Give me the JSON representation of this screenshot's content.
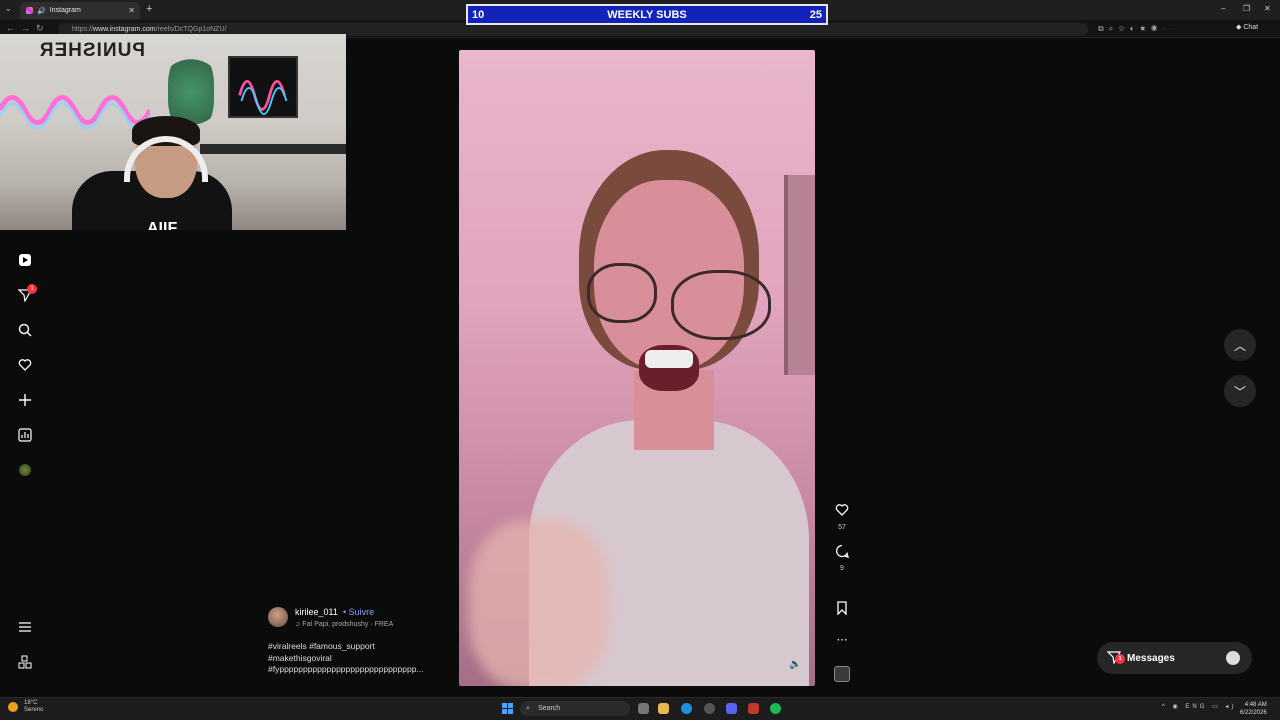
{
  "browser": {
    "tab_title": "Instagram",
    "url_prefix": "https://",
    "url_host": "www.instagram.com",
    "url_path": "/reels/DcTQGp1oNZU/",
    "chat_label": "Chat",
    "new_tab_symbol": "+"
  },
  "overlay": {
    "left_value": "10",
    "title": "WEEKLY SUBS",
    "right_value": "25"
  },
  "webcam": {
    "poster_text": "PUNISHER",
    "shirt_text": "AIIF"
  },
  "sidebar": {
    "notification_count": "1",
    "items": [
      {
        "icon": "reels-icon"
      },
      {
        "icon": "messages-icon"
      },
      {
        "icon": "search-icon"
      },
      {
        "icon": "heart-icon"
      },
      {
        "icon": "create-icon"
      },
      {
        "icon": "dashboard-icon"
      },
      {
        "icon": "profile-avatar"
      }
    ],
    "bottom_items": [
      {
        "icon": "menu-icon"
      },
      {
        "icon": "more-apps-icon"
      }
    ]
  },
  "reel": {
    "username": "kirilee_011",
    "follow_label": "Suivre",
    "audio": "Fat Papi, prodshushy · FREA",
    "hashtags_line1": "#viralreels #famous_support",
    "hashtags_line2": "#makethisgoviral",
    "hashtags_line3": "#fyppppppppppppppppppppppppppppp...",
    "likes": "57",
    "comments": "9"
  },
  "messages": {
    "label": "Messages",
    "badge": "1"
  },
  "taskbar": {
    "temperature": "18°C",
    "weather": "Sereno",
    "search_label": "Search",
    "language": "ENG",
    "time": "4:48 AM",
    "date": "6/22/2026"
  },
  "colors": {
    "overlay_blue": "#1322b8",
    "follow_blue": "#7fa6ff",
    "badge_red": "#ff3040"
  }
}
